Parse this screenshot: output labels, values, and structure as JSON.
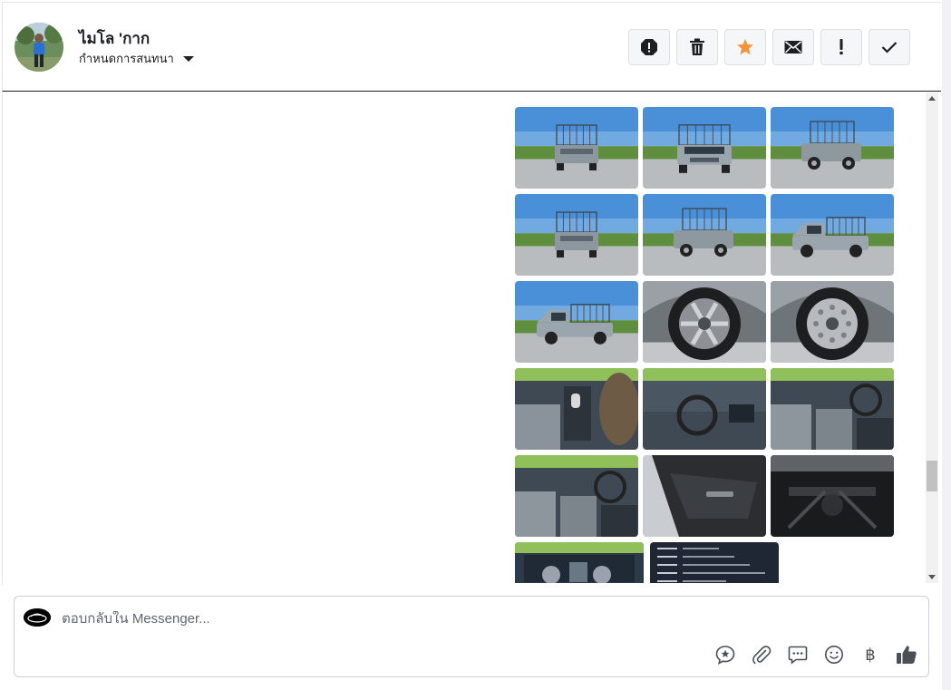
{
  "header": {
    "contact_name": "ไมโล 'กาก",
    "manage_label": "กำหนดการสนทนา",
    "actions": [
      {
        "name": "report-icon"
      },
      {
        "name": "trash-icon"
      },
      {
        "name": "star-icon",
        "color": "#f7923b"
      },
      {
        "name": "mail-icon"
      },
      {
        "name": "spam-icon"
      },
      {
        "name": "checkmark-icon"
      }
    ]
  },
  "composer": {
    "placeholder": "ตอบกลับใน Messenger...",
    "tools": [
      "saved-reply-icon",
      "attachment-icon",
      "message-template-icon",
      "emoji-icon",
      "payment-baht-icon",
      "like-icon"
    ],
    "baht_symbol": "฿"
  },
  "photos": [
    {
      "scene": "truck-rear"
    },
    {
      "scene": "truck-front"
    },
    {
      "scene": "truck-rear-side"
    },
    {
      "scene": "truck-rear"
    },
    {
      "scene": "truck-rear-side"
    },
    {
      "scene": "truck-side"
    },
    {
      "scene": "truck-side"
    },
    {
      "scene": "wheel-alloy"
    },
    {
      "scene": "wheel-steel"
    },
    {
      "scene": "interior-console"
    },
    {
      "scene": "interior-dash"
    },
    {
      "scene": "interior-seats"
    },
    {
      "scene": "interior-seats"
    },
    {
      "scene": "door-panel"
    },
    {
      "scene": "undercarriage"
    },
    {
      "scene": "engine"
    },
    {
      "scene": "document"
    }
  ],
  "colors": {
    "accent_star": "#f7923b",
    "sky": "#4a90d9",
    "icon": "#4b4f56"
  }
}
